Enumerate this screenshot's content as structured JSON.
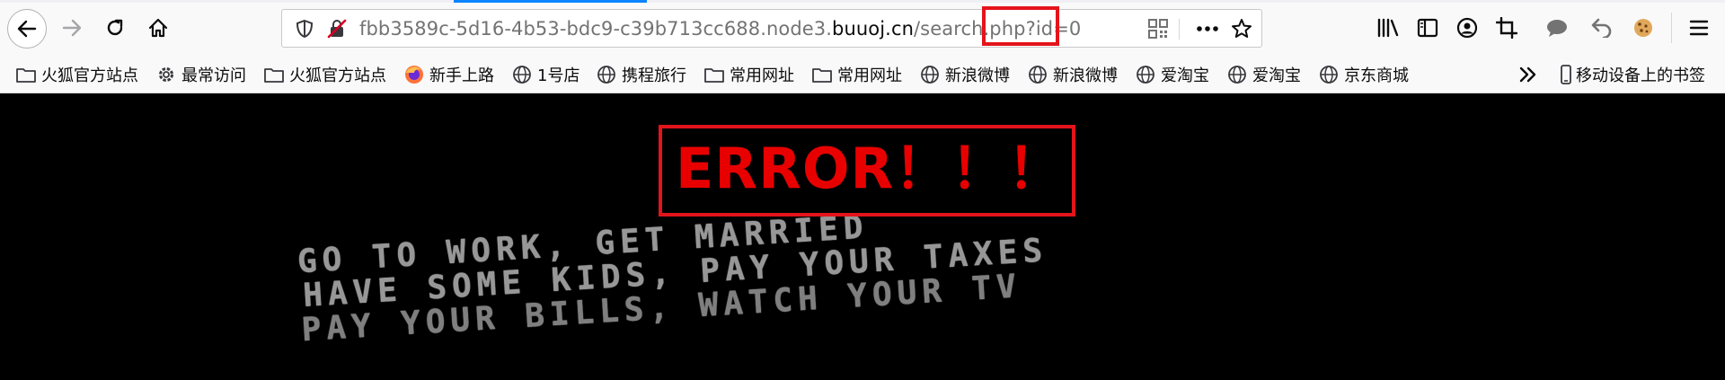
{
  "browser": {
    "url": {
      "path_before": "fbb3589c-5d16-4b53-bdc9-c39b713cc688.node3.",
      "domain": "buuoj.cn",
      "path_after": "/search.php",
      "query": "?id=0"
    },
    "bookmarks": [
      {
        "label": "火狐官方站点",
        "icon": "folder-icon"
      },
      {
        "label": "最常访问",
        "icon": "gear-icon"
      },
      {
        "label": "火狐官方站点",
        "icon": "folder-icon"
      },
      {
        "label": "新手上路",
        "icon": "firefox-icon"
      },
      {
        "label": "1号店",
        "icon": "globe-icon"
      },
      {
        "label": "携程旅行",
        "icon": "globe-icon"
      },
      {
        "label": "常用网址",
        "icon": "folder-icon"
      },
      {
        "label": "常用网址",
        "icon": "folder-icon"
      },
      {
        "label": "新浪微博",
        "icon": "globe-icon"
      },
      {
        "label": "新浪微博",
        "icon": "globe-icon"
      },
      {
        "label": "爱淘宝",
        "icon": "globe-icon"
      },
      {
        "label": "爱淘宝",
        "icon": "globe-icon"
      },
      {
        "label": "京东商城",
        "icon": "globe-icon"
      }
    ],
    "mobile_bookmarks": "移动设备上的书签"
  },
  "page": {
    "error": "ERROR！！！",
    "poster_lines": [
      "GO TO WORK, GET MARRIED",
      "HAVE SOME KIDS, PAY YOUR TAXES",
      "PAY YOUR BILLS, WATCH YOUR TV"
    ]
  },
  "colors": {
    "highlight": "#e4141b",
    "error_text": "#e80000",
    "accent": "#0a84ff"
  }
}
